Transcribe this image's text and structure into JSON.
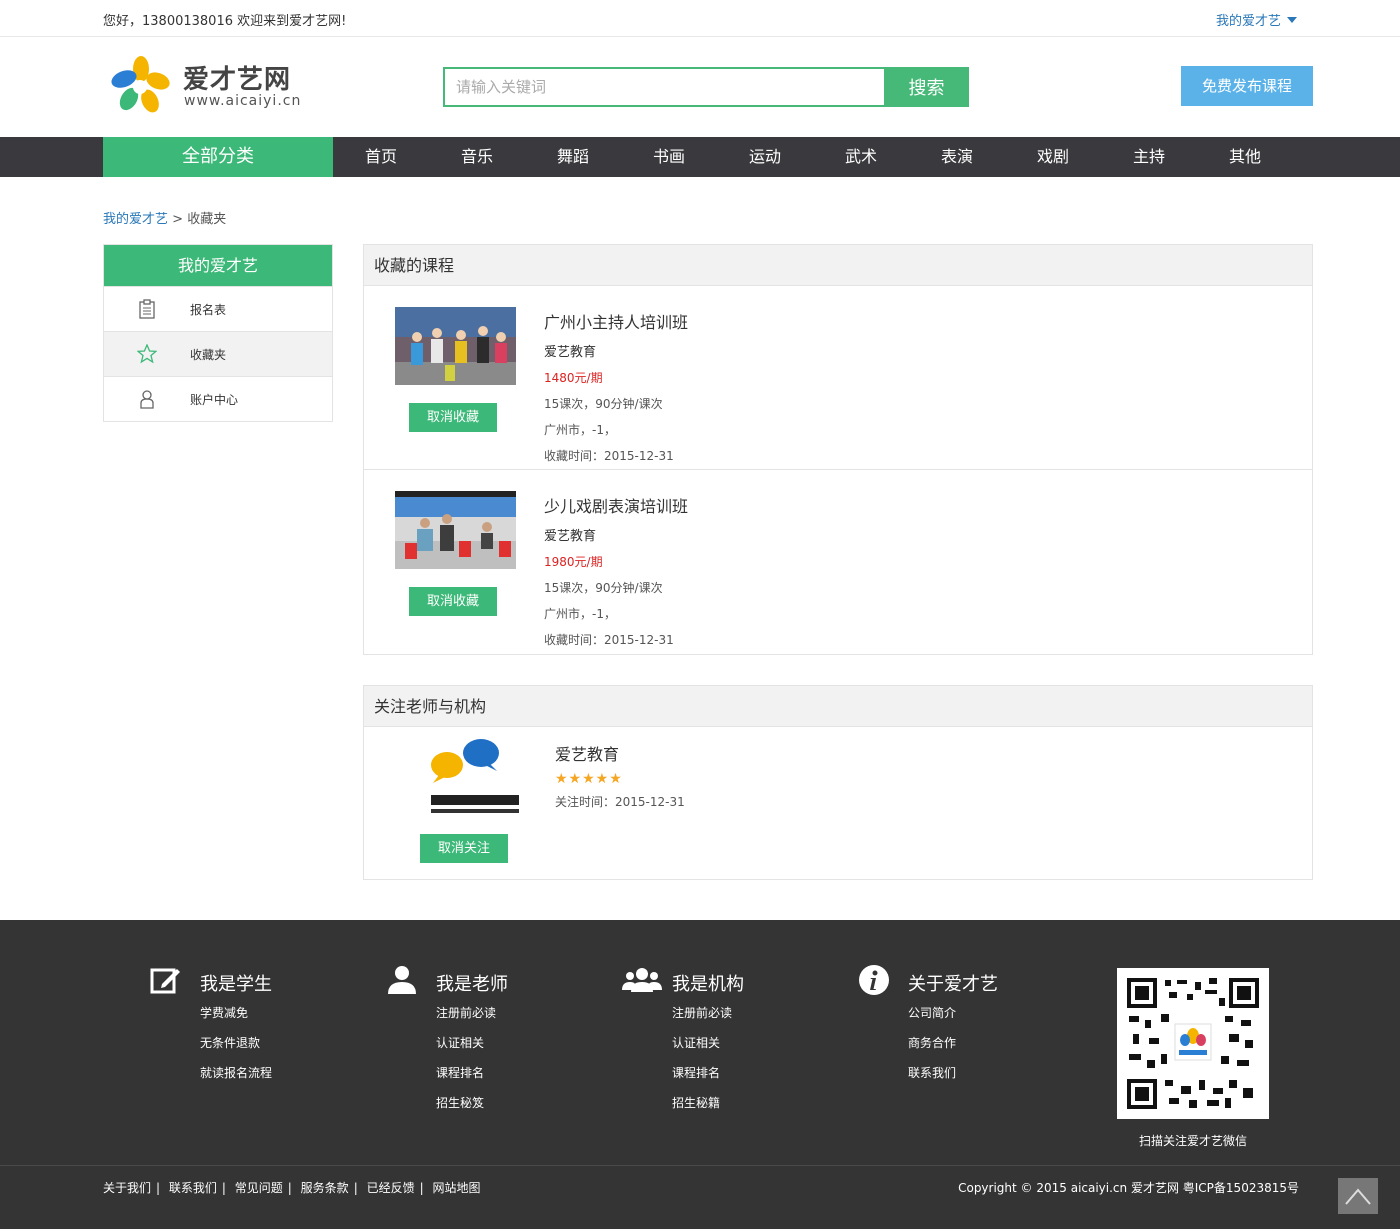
{
  "topbar": {
    "welcome": "您好，13800138016 欢迎来到爱才艺网!",
    "my_link": "我的爱才艺"
  },
  "header": {
    "logo_name": "爱才艺网",
    "logo_url": "www.aicaiyi.cn",
    "search_placeholder": "请输入关键词",
    "search_button": "搜索",
    "publish_button": "免费发布课程"
  },
  "nav": {
    "all_categories": "全部分类",
    "items": [
      "首页",
      "音乐",
      "舞蹈",
      "书画",
      "运动",
      "武术",
      "表演",
      "戏剧",
      "主持",
      "其他"
    ]
  },
  "breadcrumb": {
    "root": "我的爱才艺",
    "separator": ">",
    "current": "收藏夹"
  },
  "sidebar": {
    "title": "我的爱才艺",
    "items": [
      {
        "label": "报名表",
        "icon": "clipboard-icon"
      },
      {
        "label": "收藏夹",
        "icon": "star-icon"
      },
      {
        "label": "账户中心",
        "icon": "user-icon"
      }
    ]
  },
  "favorites": {
    "title": "收藏的课程",
    "cancel_label": "取消收藏",
    "courses": [
      {
        "title": "广州小主持人培训班",
        "org": "爱艺教育",
        "price": "1480元/期",
        "sessions": "15课次，90分钟/课次",
        "location": "广州市，-1，",
        "fav_time": "收藏时间：2015-12-31"
      },
      {
        "title": "少儿戏剧表演培训班",
        "org": "爱艺教育",
        "price": "1980元/期",
        "sessions": "15课次，90分钟/课次",
        "location": "广州市，-1，",
        "fav_time": "收藏时间：2015-12-31"
      }
    ]
  },
  "follows": {
    "title": "关注老师与机构",
    "cancel_label": "取消关注",
    "orgs": [
      {
        "name": "爱艺教育",
        "stars": "★★★★★",
        "rating": 5,
        "follow_time": "关注时间：2015-12-31"
      }
    ]
  },
  "footer": {
    "columns": [
      {
        "title": "我是学生",
        "icon": "edit-icon",
        "links": [
          "学费减免",
          "无条件退款",
          "就读报名流程"
        ]
      },
      {
        "title": "我是老师",
        "icon": "person-icon",
        "links": [
          "注册前必读",
          "认证相关",
          "课程排名",
          "招生秘笈"
        ]
      },
      {
        "title": "我是机构",
        "icon": "group-icon",
        "links": [
          "注册前必读",
          "认证相关",
          "课程排名",
          "招生秘籍"
        ]
      },
      {
        "title": "关于爱才艺",
        "icon": "info-icon",
        "links": [
          "公司简介",
          "商务合作",
          "联系我们"
        ]
      }
    ],
    "qr_caption": "扫描关注爱才艺微信",
    "bottom_links": [
      "关于我们",
      "联系我们",
      "常见问题",
      "服务条款",
      "已经反馈",
      "网站地图"
    ],
    "copyright": "Copyright © 2015 aicaiyi.cn 爱才艺网 粤ICP备15023815号"
  },
  "colors": {
    "green": "#3cb878",
    "nav_bg": "#3a3a3e",
    "link_blue": "#2a78b8",
    "price_red": "#dd2222",
    "footer_bg": "#343434",
    "publish_blue": "#5bb2e8"
  }
}
